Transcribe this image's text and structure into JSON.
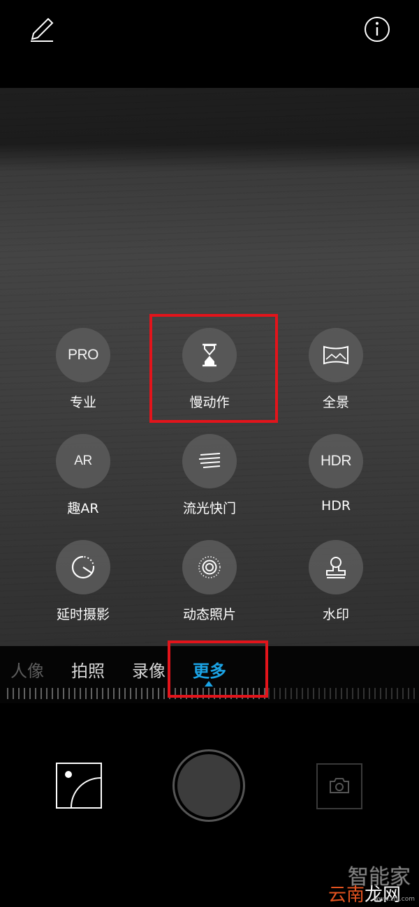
{
  "modes": [
    {
      "label": "专业",
      "icon_text": "PRO",
      "icon": "pro-icon"
    },
    {
      "label": "慢动作",
      "icon": "hourglass-icon"
    },
    {
      "label": "全景",
      "icon": "panorama-icon"
    },
    {
      "label": "趣AR",
      "icon_text": "AR",
      "icon": "ar-icon"
    },
    {
      "label": "流光快门",
      "icon": "light-trails-icon"
    },
    {
      "label": "HDR",
      "icon_text": "HDR",
      "icon": "hdr-icon"
    },
    {
      "label": "延时摄影",
      "icon": "timelapse-icon"
    },
    {
      "label": "动态照片",
      "icon": "moving-picture-icon"
    },
    {
      "label": "水印",
      "icon": "watermark-stamp-icon"
    }
  ],
  "tabs": [
    {
      "label": "人像"
    },
    {
      "label": "拍照"
    },
    {
      "label": "录像"
    },
    {
      "label": "更多",
      "active": true
    }
  ],
  "watermark": {
    "line1": "智能家",
    "line2a": "云南",
    "line2b": "龙网",
    "line3": "www.znj.com"
  },
  "colors": {
    "accent": "#1ba4e6",
    "highlight": "#e3141b"
  }
}
